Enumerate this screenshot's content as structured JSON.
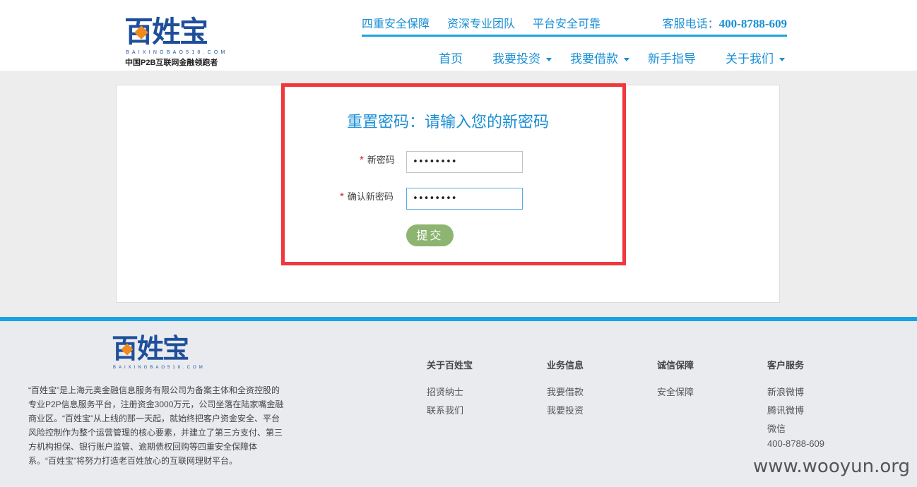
{
  "header": {
    "logo": {
      "mark": "百姓宝",
      "sub": "BAIXINGBAO518.COM",
      "slogan": "中国P2B互联网金融领跑者"
    },
    "top_links": [
      "四重安全保障",
      "资深专业团队",
      "平台安全可靠"
    ],
    "hotline_label": "客服电话：",
    "hotline_number": "400-8788-609",
    "nav": {
      "home": "首页",
      "invest": "我要投资",
      "borrow": "我要借款",
      "guide": "新手指导",
      "about": "关于我们"
    }
  },
  "form": {
    "title": "重置密码：请输入您的新密码",
    "required_mark": "*",
    "new_password_label": "新密码",
    "new_password_value": "••••••••",
    "confirm_label": "确认新密码",
    "confirm_value": "••••••••",
    "submit_label": "提交"
  },
  "footer": {
    "logo": {
      "mark": "百姓宝",
      "sub": "BAIXINGBAO518.COM"
    },
    "about_text": "“百姓宝”是上海元奥金融信息服务有限公司为备案主体和全资控股的专业P2P信息服务平台，注册资金3000万元，公司坐落在陆家嘴金融商业区。“百姓宝”从上线的那一天起，就始终把客户资金安全、平台风险控制作为整个运营管理的核心要素，并建立了第三方支付、第三方机构担保、银行账户监管、逾期债权回购等四重安全保障体系。“百姓宝”将努力打造老百姓放心的互联网理财平台。",
    "columns": {
      "about": {
        "title": "关于百姓宝",
        "links": [
          "招贤纳士",
          "联系我们"
        ]
      },
      "business": {
        "title": "业务信息",
        "links": [
          "我要借款",
          "我要投资"
        ]
      },
      "trust": {
        "title": "诚信保障",
        "links": [
          "安全保障"
        ]
      },
      "service": {
        "title": "客户服务",
        "links": [
          "新浪微博",
          "腾讯微博",
          "微信",
          "400-8788-609"
        ]
      }
    }
  },
  "watermark": "www.wooyun.org",
  "colors": {
    "brand_blue": "#1a8fd4",
    "logo_blue": "#1f4f9b",
    "accent_orange": "#f08a1e",
    "highlight_red": "#f0373d",
    "submit_green": "#8db470"
  }
}
